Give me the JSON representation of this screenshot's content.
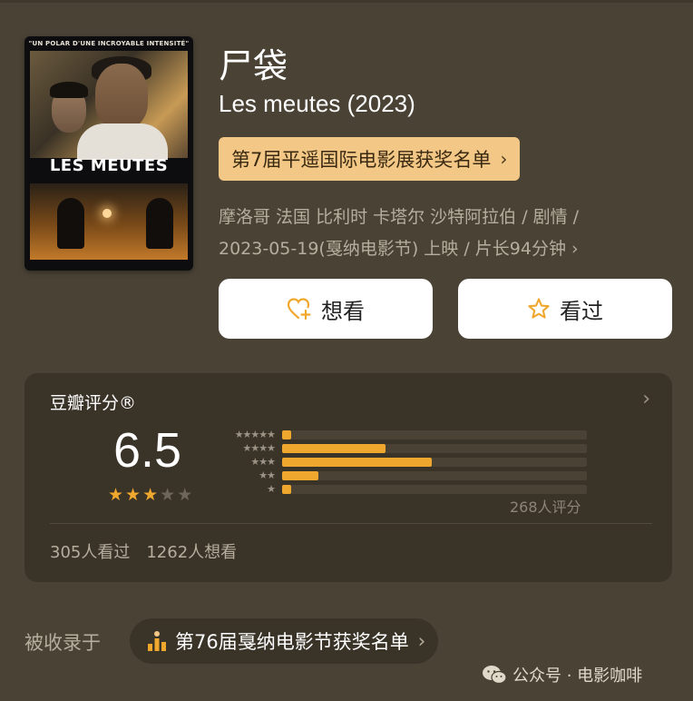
{
  "movie": {
    "title_cn": "尸袋",
    "title_original": "Les meutes (2023)",
    "award_link": "第7届平遥国际电影展获奖名单",
    "meta_line1": "摩洛哥 法国 比利时 卡塔尔 沙特阿拉伯 / 剧情 /",
    "meta_line2": "2023-05-19(戛纳电影节) 上映 / 片长94分钟"
  },
  "poster": {
    "tagline": "\"UN POLAR D'UNE INCROYABLE INTENSITÉ\"",
    "title": "LES MEUTES"
  },
  "actions": {
    "want_label": "想看",
    "seen_label": "看过"
  },
  "rating": {
    "label": "豆瓣评分®",
    "score": "6.5",
    "stars_filled": 3,
    "stars_total": 5,
    "count_text": "268人评分",
    "distribution": [
      {
        "stars": 5,
        "fraction": 0.03
      },
      {
        "stars": 4,
        "fraction": 0.34
      },
      {
        "stars": 3,
        "fraction": 0.49
      },
      {
        "stars": 2,
        "fraction": 0.12
      },
      {
        "stars": 1,
        "fraction": 0.03
      }
    ],
    "seen_text": "305人看过",
    "want_text": "1262人想看"
  },
  "collection": {
    "label": "被收录于",
    "list_name": "第76届戛纳电影节获奖名单"
  },
  "watermark": "公众号 · 电影咖啡",
  "colors": {
    "background": "#4a4235",
    "card": "#3a3328",
    "accent": "#f0a72e",
    "award_pill": "#f3c785"
  }
}
